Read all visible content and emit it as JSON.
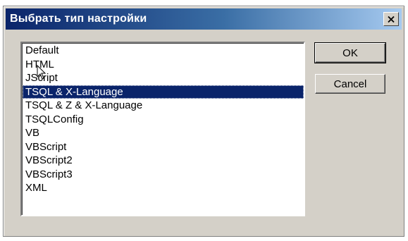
{
  "window": {
    "title": "Выбрать тип настройки",
    "close_icon": "close-icon"
  },
  "list": {
    "items": [
      {
        "label": "Default",
        "selected": false
      },
      {
        "label": "HTML",
        "selected": false
      },
      {
        "label": "JScript",
        "selected": false
      },
      {
        "label": "TSQL & X-Language",
        "selected": true
      },
      {
        "label": "TSQL & Z & X-Language",
        "selected": false
      },
      {
        "label": "TSQLConfig",
        "selected": false
      },
      {
        "label": "VB",
        "selected": false
      },
      {
        "label": "VBScript",
        "selected": false
      },
      {
        "label": "VBScript2",
        "selected": false
      },
      {
        "label": "VBScript3",
        "selected": false
      },
      {
        "label": "XML",
        "selected": false
      }
    ]
  },
  "buttons": {
    "ok_label": "OK",
    "cancel_label": "Cancel"
  },
  "colors": {
    "selection": "#0a246a",
    "dialog_face": "#d4d0c8"
  }
}
